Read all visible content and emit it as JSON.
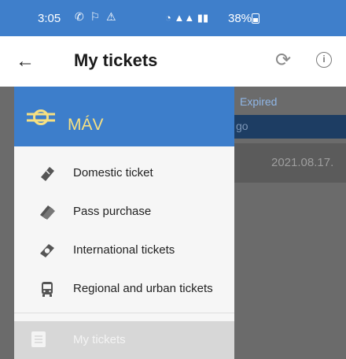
{
  "status_bar": {
    "time": "3:05",
    "battery": "38%"
  },
  "app_bar": {
    "title": "My tickets"
  },
  "background_list": {
    "tab_label": "Expired",
    "group_label": "go",
    "date": "2021.08.17."
  },
  "drawer": {
    "brand": "MÁV",
    "menu_items": [
      {
        "label": "Domestic ticket",
        "icon": "ticket-icon"
      },
      {
        "label": "Pass purchase",
        "icon": "pass-icon"
      },
      {
        "label": "International tickets",
        "icon": "international-ticket-icon"
      },
      {
        "label": "Regional and urban tickets",
        "icon": "bus-icon"
      }
    ],
    "selected_item": {
      "label": "My tickets",
      "icon": "list-icon"
    }
  },
  "colors": {
    "header_blue": "#3d7ecb",
    "brand_yellow": "#f7e081",
    "scrim": "#6b6b6b"
  }
}
